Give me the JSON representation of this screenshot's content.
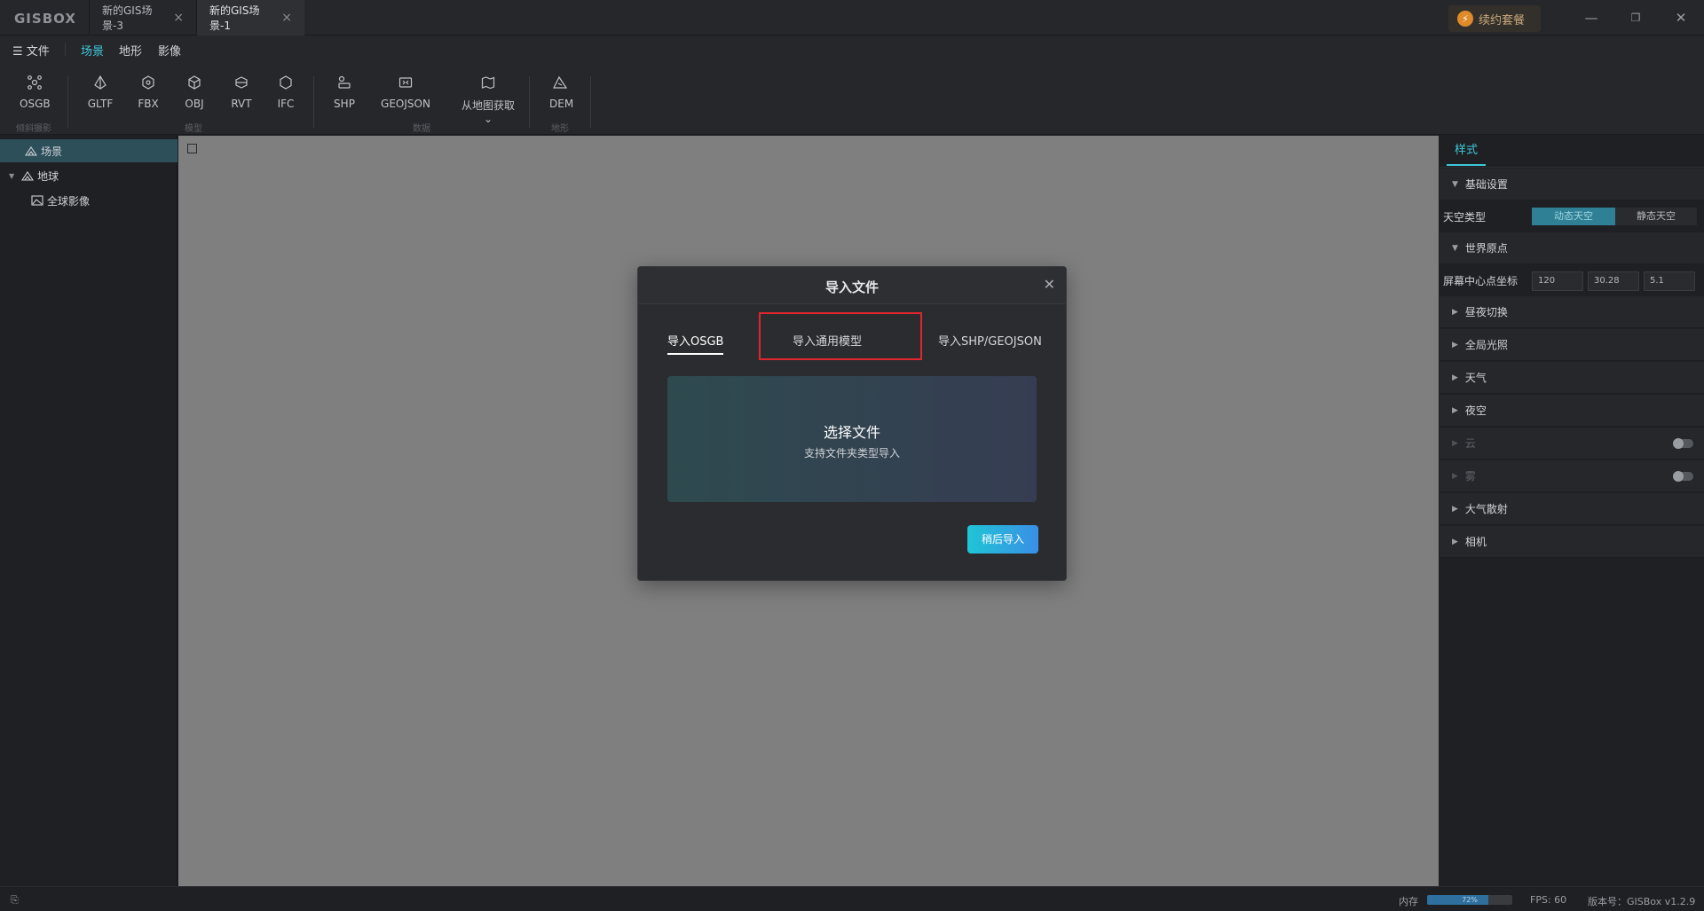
{
  "app": {
    "logo": "GISBOX",
    "tabs": [
      {
        "label": "新的GIS场景-3"
      },
      {
        "label": "新的GIS场景-1"
      }
    ],
    "renew_label": "续约套餐",
    "window_controls": {
      "minimize": "—",
      "restore": "❐",
      "close": "✕"
    }
  },
  "menu": {
    "file_label": "文件",
    "items": [
      {
        "label": "场景",
        "active": true
      },
      {
        "label": "地形"
      },
      {
        "label": "影像"
      }
    ]
  },
  "toolbar": {
    "tools": [
      {
        "label": "OSGB",
        "icon": "osgb-icon"
      },
      {
        "label": "GLTF",
        "icon": "gltf-icon"
      },
      {
        "label": "FBX",
        "icon": "fbx-icon"
      },
      {
        "label": "OBJ",
        "icon": "obj-icon"
      },
      {
        "label": "RVT",
        "icon": "rvt-icon"
      },
      {
        "label": "IFC",
        "icon": "ifc-icon"
      },
      {
        "label": "SHP",
        "icon": "shp-icon"
      },
      {
        "label": "GEOJSON",
        "icon": "geojson-icon"
      },
      {
        "label": "从地图获取",
        "icon": "map-fetch-icon"
      },
      {
        "label": "DEM",
        "icon": "dem-icon"
      }
    ],
    "groups": [
      "倾斜摄影",
      "模型",
      "数据",
      "地形"
    ]
  },
  "layers": [
    {
      "label": "场景",
      "selected": true
    },
    {
      "label": "地球"
    },
    {
      "label": "全球影像"
    }
  ],
  "style_panel": {
    "tab": "样式",
    "basic_settings": "基础设置",
    "sky_type_label": "天空类型",
    "sky_options": [
      "动态天空",
      "静态天空"
    ],
    "sky_selected": "动态天空",
    "world_origin": "世界原点",
    "center_label": "屏幕中心点坐标",
    "center_values": [
      "120",
      "30.28",
      "5.1"
    ],
    "sections": [
      {
        "label": "昼夜切换",
        "disabled": false
      },
      {
        "label": "全局光照",
        "disabled": false
      },
      {
        "label": "天气",
        "disabled": false
      },
      {
        "label": "夜空",
        "disabled": false
      },
      {
        "label": "云",
        "disabled": true,
        "toggle": false
      },
      {
        "label": "雾",
        "disabled": true,
        "toggle": false
      },
      {
        "label": "大气散射",
        "disabled": false
      },
      {
        "label": "相机",
        "disabled": false
      }
    ]
  },
  "dialog": {
    "title": "导入文件",
    "tabs": [
      {
        "label": "导入OSGB",
        "active": true
      },
      {
        "label": "导入通用模型"
      },
      {
        "label": "导入SHP/GEOJSON"
      }
    ],
    "dropzone_title": "选择文件",
    "dropzone_subtitle": "支持文件夹类型导入",
    "later_button": "稍后导入"
  },
  "status": {
    "memory_label": "内存",
    "memory_percent": 72,
    "memory_text": "72%",
    "fps": "FPS: 60",
    "version": "版本号：GISBox v1.2.9"
  }
}
